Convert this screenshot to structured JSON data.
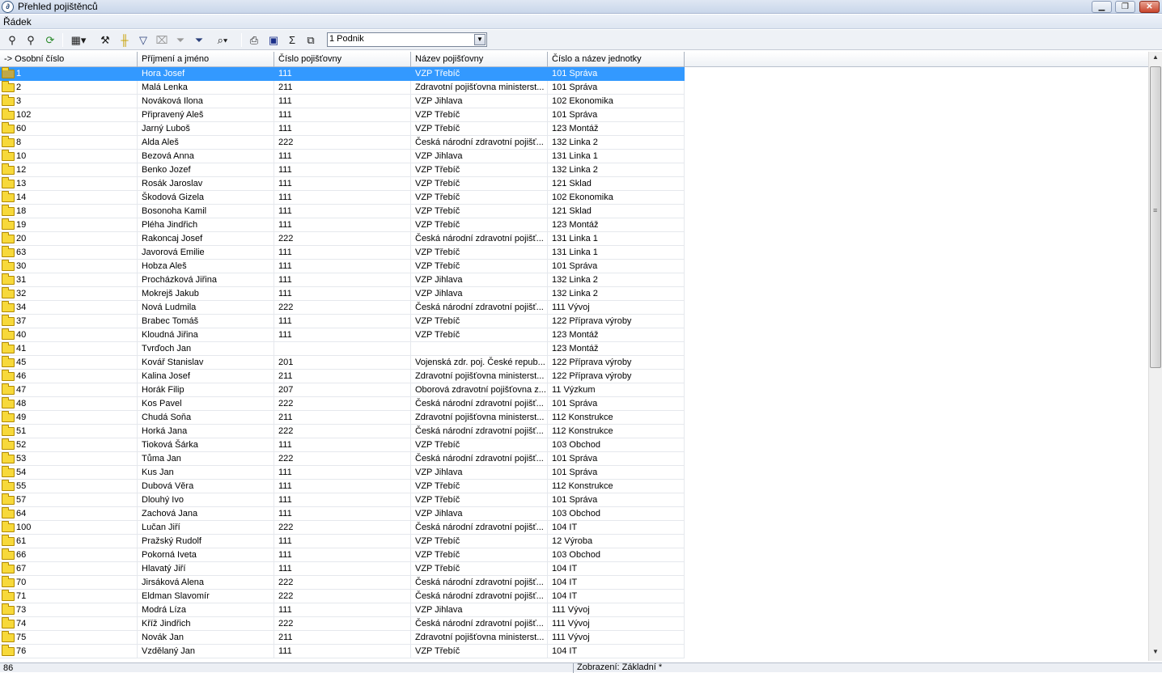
{
  "window": {
    "title": "Přehled pojištěnců",
    "app_icon": "app-logo-icon",
    "controls": [
      "minimize-icon",
      "restore-icon",
      "close-icon"
    ]
  },
  "menu": {
    "radek": "Řádek"
  },
  "toolbar": {
    "icons": [
      "binoculars-find-icon",
      "binoculars-find-next-icon",
      "refresh-icon",
      "grid-view-icon",
      "tools-icon",
      "column-layout-icon",
      "filter-icon",
      "clear-filter-icon",
      "filter-disabled-icon",
      "filter-apply-icon",
      "zoom-icon",
      "print-icon",
      "save-icon",
      "sum-icon",
      "copy-icon"
    ],
    "company_select": {
      "value": "1 Podnik"
    }
  },
  "grid": {
    "columns": [
      "-> Osobní číslo",
      "Příjmení a jméno",
      "Číslo pojišťovny",
      "Název pojišťovny",
      "Číslo a název jednotky"
    ],
    "selected_row": 0,
    "rows": [
      [
        "1",
        "Hora Josef",
        "111",
        "VZP Třebíč",
        "101 Správa"
      ],
      [
        "2",
        "Malá Lenka",
        "211",
        "Zdravotní pojišťovna ministerst...",
        "101 Správa"
      ],
      [
        "3",
        "Nováková Ilona",
        "111",
        "VZP Jihlava",
        "102 Ekonomika"
      ],
      [
        "102",
        "Připravený Aleš",
        "111",
        "VZP Třebíč",
        "101 Správa"
      ],
      [
        "60",
        "Jarný Luboš",
        "111",
        "VZP Třebíč",
        "123 Montáž"
      ],
      [
        "8",
        "Alda Aleš",
        "222",
        "Česká národní zdravotní pojišť...",
        "132 Linka  2"
      ],
      [
        "10",
        "Bezová Anna",
        "111",
        "VZP Jihlava",
        "131 Linka 1"
      ],
      [
        "12",
        "Benko Jozef",
        "111",
        "VZP Třebíč",
        "132 Linka  2"
      ],
      [
        "13",
        "Rosák Jaroslav",
        "111",
        "VZP Třebíč",
        "121 Sklad"
      ],
      [
        "14",
        "Škodová Gizela",
        "111",
        "VZP Třebíč",
        "102 Ekonomika"
      ],
      [
        "18",
        "Bosonoha Kamil",
        "111",
        "VZP Třebíč",
        "121 Sklad"
      ],
      [
        "19",
        "Pléha Jindřich",
        "111",
        "VZP Třebíč",
        "123 Montáž"
      ],
      [
        "20",
        "Rakoncaj Josef",
        "222",
        "Česká národní zdravotní pojišť...",
        "131 Linka 1"
      ],
      [
        "63",
        "Javorová Emilie",
        "111",
        "VZP Třebíč",
        "131 Linka 1"
      ],
      [
        "30",
        "Hobza Aleš",
        "111",
        "VZP Třebíč",
        "101 Správa"
      ],
      [
        "31",
        "Procházková Jiřina",
        "111",
        "VZP Jihlava",
        "132 Linka  2"
      ],
      [
        "32",
        "Mokrejš Jakub",
        "111",
        "VZP Jihlava",
        "132 Linka  2"
      ],
      [
        "34",
        "Nová Ludmila",
        "222",
        "Česká národní zdravotní pojišť...",
        "111 Vývoj"
      ],
      [
        "37",
        "Brabec Tomáš",
        "111",
        "VZP Třebíč",
        "122 Příprava výroby"
      ],
      [
        "40",
        "Kloudná Jiřina",
        "111",
        "VZP Třebíč",
        "123 Montáž"
      ],
      [
        "41",
        "Tvrďoch Jan",
        "",
        "",
        "123 Montáž"
      ],
      [
        "45",
        "Kovář Stanislav",
        "201",
        "Vojenská zdr. poj. České repub...",
        "122 Příprava výroby"
      ],
      [
        "46",
        "Kalina Josef",
        "211",
        "Zdravotní pojišťovna ministerst...",
        "122 Příprava výroby"
      ],
      [
        "47",
        "Horák Filip",
        "207",
        "Oborová zdravotní pojišťovna z...",
        "11 Výzkum"
      ],
      [
        "48",
        "Kos Pavel",
        "222",
        "Česká národní zdravotní pojišť...",
        "101 Správa"
      ],
      [
        "49",
        "Chudá Soňa",
        "211",
        "Zdravotní pojišťovna ministerst...",
        "112 Konstrukce"
      ],
      [
        "51",
        "Horká Jana",
        "222",
        "Česká národní zdravotní pojišť...",
        "112 Konstrukce"
      ],
      [
        "52",
        "Tioková Šárka",
        "111",
        "VZP Třebíč",
        "103 Obchod"
      ],
      [
        "53",
        "Tůma Jan",
        "222",
        "Česká národní zdravotní pojišť...",
        "101 Správa"
      ],
      [
        "54",
        "Kus Jan",
        "111",
        "VZP Jihlava",
        "101 Správa"
      ],
      [
        "55",
        "Dubová Věra",
        "111",
        "VZP Třebíč",
        "112 Konstrukce"
      ],
      [
        "57",
        "Dlouhý Ivo",
        "111",
        "VZP Třebíč",
        "101 Správa"
      ],
      [
        "64",
        "Zachová Jana",
        "111",
        "VZP Jihlava",
        "103 Obchod"
      ],
      [
        "100",
        "Lučan Jiří",
        "222",
        "Česká národní zdravotní pojišť...",
        "104 IT"
      ],
      [
        "61",
        "Pražský Rudolf",
        "111",
        "VZP Třebíč",
        "12 Výroba"
      ],
      [
        "66",
        "Pokorná Iveta",
        "111",
        "VZP Třebíč",
        "103 Obchod"
      ],
      [
        "67",
        "Hlavatý Jiří",
        "111",
        "VZP Třebíč",
        "104 IT"
      ],
      [
        "70",
        "Jirsáková Alena",
        "222",
        "Česká národní zdravotní pojišť...",
        "104 IT"
      ],
      [
        "71",
        "Eldman Slavomír",
        "222",
        "Česká národní zdravotní pojišť...",
        "104 IT"
      ],
      [
        "73",
        "Modrá Líza",
        "111",
        "VZP Jihlava",
        "111 Vývoj"
      ],
      [
        "74",
        "Kříž Jindřich",
        "222",
        "Česká národní zdravotní pojišť...",
        "111 Vývoj"
      ],
      [
        "75",
        "Novák Jan",
        "211",
        "Zdravotní pojišťovna ministerst...",
        "111 Vývoj"
      ],
      [
        "76",
        "Vzdělaný Jan",
        "111",
        "VZP Třebíč",
        "104 IT"
      ]
    ]
  },
  "status": {
    "count": "86",
    "view": "Zobrazení: Základní *"
  }
}
